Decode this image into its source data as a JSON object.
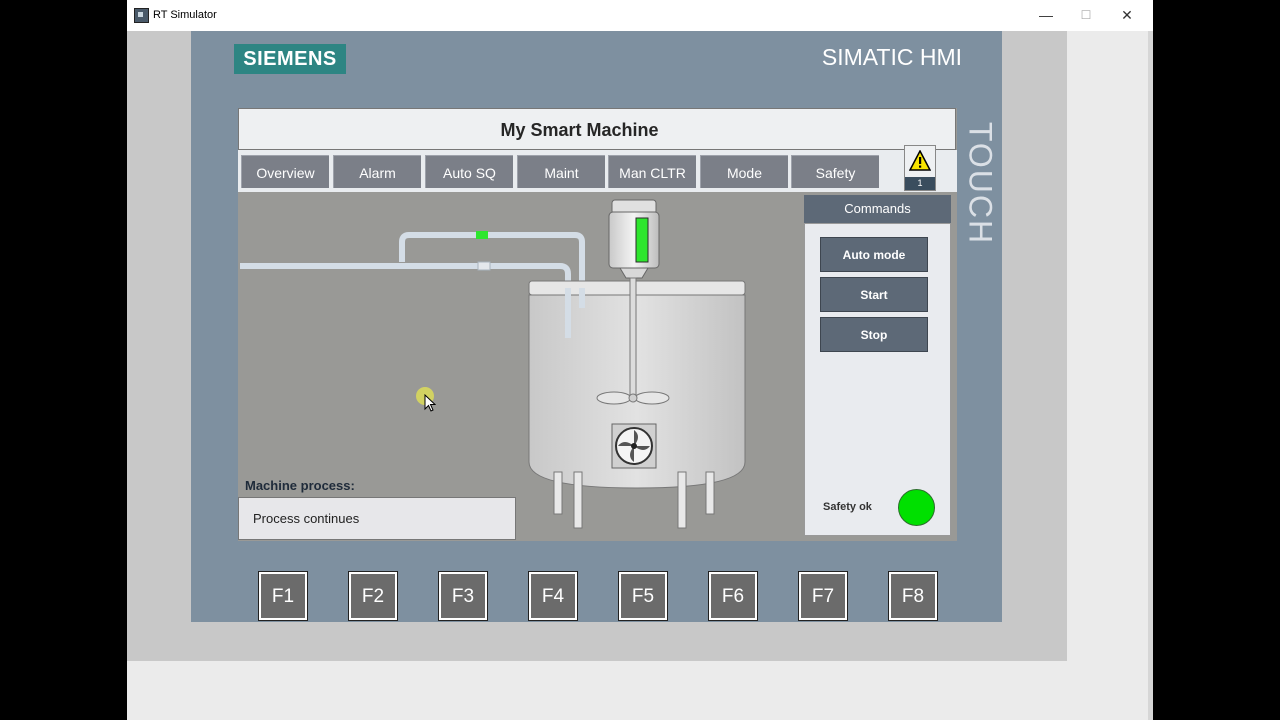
{
  "window": {
    "title": "RT Simulator",
    "minimize_glyph": "—",
    "maximize_glyph": "☐",
    "close_glyph": "✕"
  },
  "device": {
    "brand": "SIEMENS",
    "product": "SIMATIC HMI",
    "side_label": "TOUCH"
  },
  "screen": {
    "title": "My Smart Machine",
    "tabs": [
      {
        "label": "Overview"
      },
      {
        "label": "Alarm"
      },
      {
        "label": "Auto SQ"
      },
      {
        "label": "Maint"
      },
      {
        "label": "Man CLTR"
      },
      {
        "label": "Mode"
      },
      {
        "label": "Safety"
      }
    ],
    "alarm_count": "1",
    "machine_process_label": "Machine process:",
    "machine_process_value": "Process continues"
  },
  "commands": {
    "title": "Commands",
    "buttons": [
      {
        "label": "Auto mode"
      },
      {
        "label": "Start"
      },
      {
        "label": "Stop"
      }
    ],
    "safety_label": "Safety ok"
  },
  "function_keys": [
    "F1",
    "F2",
    "F3",
    "F4",
    "F5",
    "F6",
    "F7",
    "F8"
  ],
  "colors": {
    "brand_teal": "#2d8583",
    "panel_blue_grey": "#7e90a0",
    "button_grey": "#5d6977",
    "safety_ok_green": "#00e000",
    "motor_indicator_green": "#2ee62e"
  }
}
